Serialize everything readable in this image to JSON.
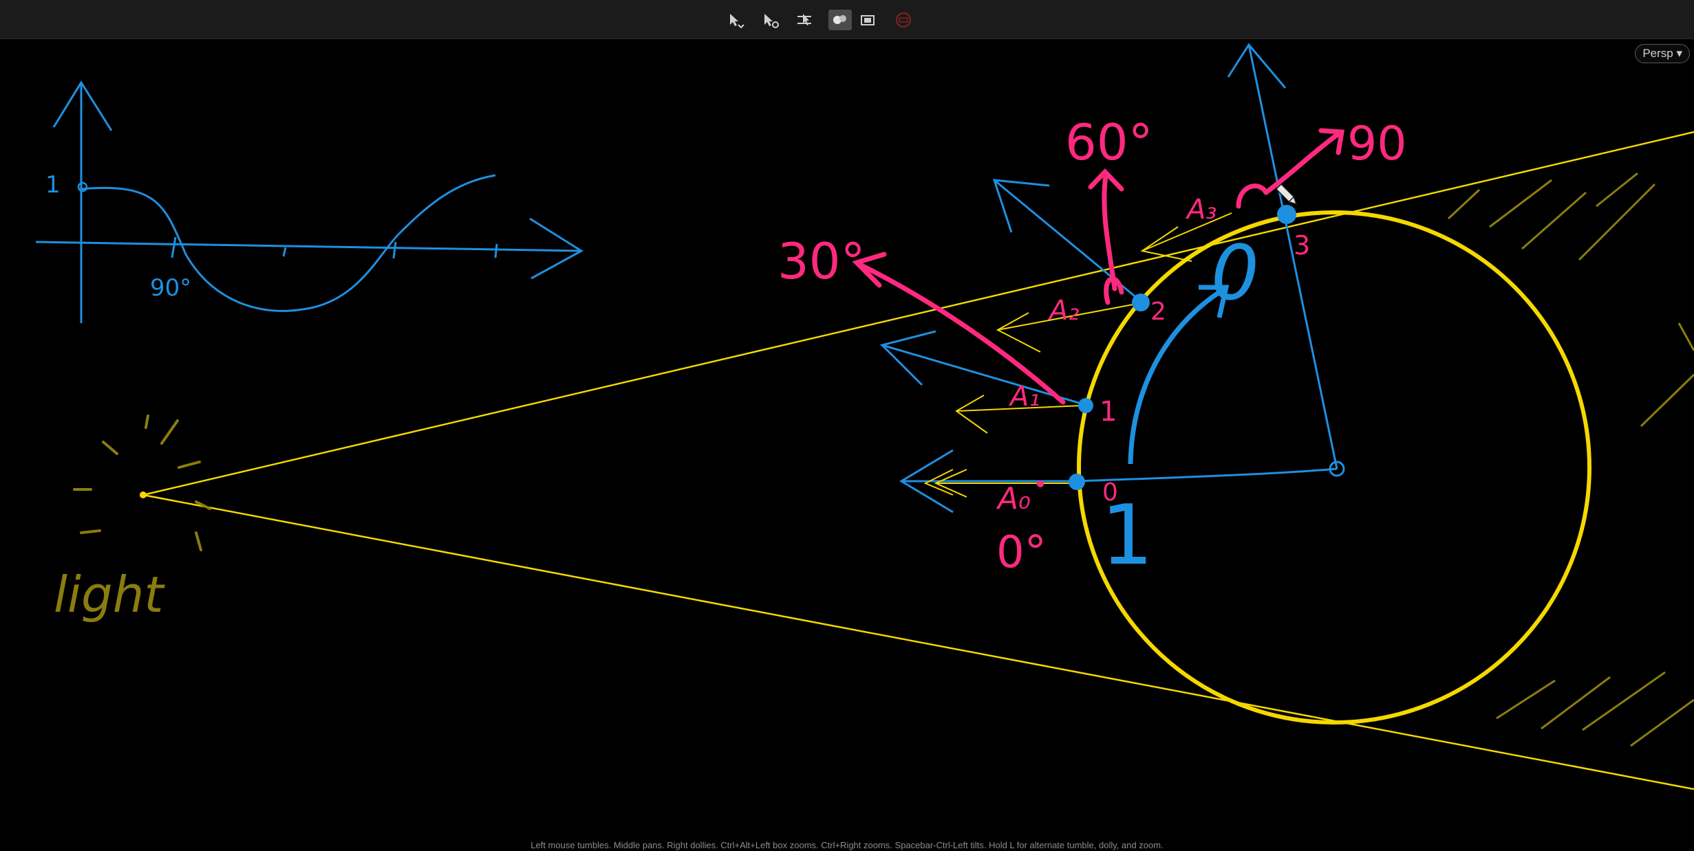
{
  "toolbar": {
    "icons": [
      "select-tool-icon",
      "lasso-select-icon",
      "paint-select-icon",
      "camera-tumble-icon",
      "display-mode-icon",
      "isolate-icon"
    ]
  },
  "viewport": {
    "camera_button": "Persp",
    "status_hint": "Left mouse tumbles. Middle pans. Right dollies. Ctrl+Alt+Left box zooms. Ctrl+Right zooms. Spacebar-Ctrl-Left tilts. Hold L for alternate tumble, dolly, and zoom."
  },
  "drawing": {
    "graph_one_label": "1",
    "graph_ninety_label": "90°",
    "light_label": "light",
    "angle_60": "60°",
    "angle_90": "90",
    "angle_30": "30°",
    "angle_0": "0°",
    "big_zero": "0",
    "big_one": "1",
    "point_labels": [
      "0",
      "1",
      "2",
      "3"
    ],
    "area_labels": [
      "A₀",
      "A₁",
      "A₂",
      "A₃"
    ]
  },
  "colors": {
    "background": "#000000",
    "blue_ink": "#1e90e0",
    "pink_ink": "#ff2a7f",
    "yellow_ink": "#f5d800",
    "olive_ink": "#8a7d10"
  }
}
